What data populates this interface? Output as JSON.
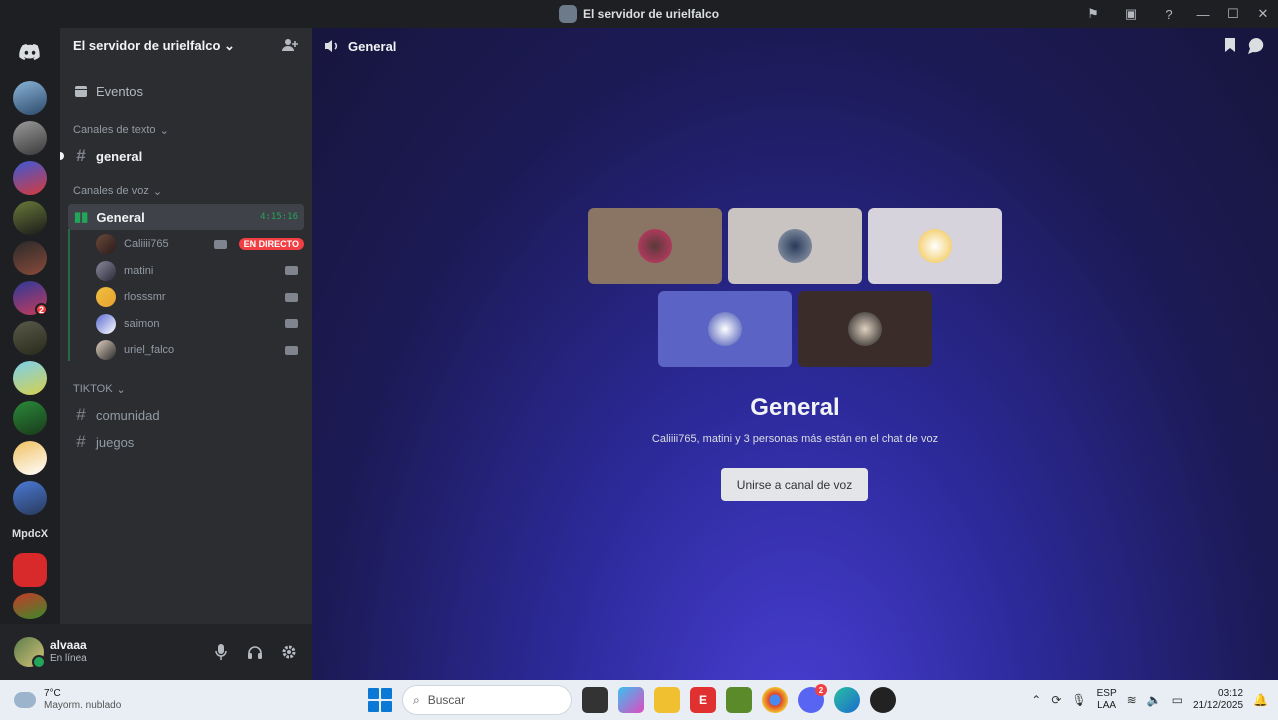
{
  "window": {
    "title": "El servidor de urielfalco"
  },
  "server": {
    "name": "El servidor de urielfalco"
  },
  "events_label": "Eventos",
  "categories": {
    "text": "Canales de texto",
    "voice": "Canales de voz",
    "tiktok": "TIKTOK"
  },
  "text_channels": [
    {
      "name": "general"
    }
  ],
  "voice_channel": {
    "name": "General",
    "timer": "4:15:16"
  },
  "voice_users": [
    {
      "name": "Caliiii765",
      "badge": "EN DIRECTO"
    },
    {
      "name": "matini"
    },
    {
      "name": "rlosssmr"
    },
    {
      "name": "saimon"
    },
    {
      "name": "uriel_falco"
    }
  ],
  "tiktok_channels": [
    {
      "name": "comunidad"
    },
    {
      "name": "juegos"
    }
  ],
  "guild_text": "MpdcX",
  "guild_badge_count": "2",
  "user": {
    "name": "alvaaa",
    "status": "En línea"
  },
  "main": {
    "header_title": "General",
    "vc_title": "General",
    "vc_subtitle": "Caliiii765, matini y 3 personas más están en el chat de voz",
    "join_button": "Unirse a canal de voz"
  },
  "icons": {
    "discord_home": "discord-logo-icon",
    "invite": "add-person-icon",
    "calendar": "calendar-icon",
    "speaker": "speaker-icon",
    "bookmark": "bookmark-icon",
    "chat": "chat-bubble-icon",
    "mic": "microphone-icon",
    "headphones": "headphones-icon",
    "settings": "gear-icon"
  },
  "colors": {
    "accent_green": "#23a55a",
    "live_red": "#f23f43",
    "sidebar_bg": "#2b2d31",
    "rail_bg": "#1e1f22"
  },
  "taskbar": {
    "weather_temp": "7°C",
    "weather_desc": "Mayorm. nublado",
    "search_placeholder": "Buscar",
    "discord_badge": "2",
    "lang_top": "ESP",
    "lang_bottom": "LAA",
    "time": "03:12",
    "date": "21/12/2025"
  }
}
